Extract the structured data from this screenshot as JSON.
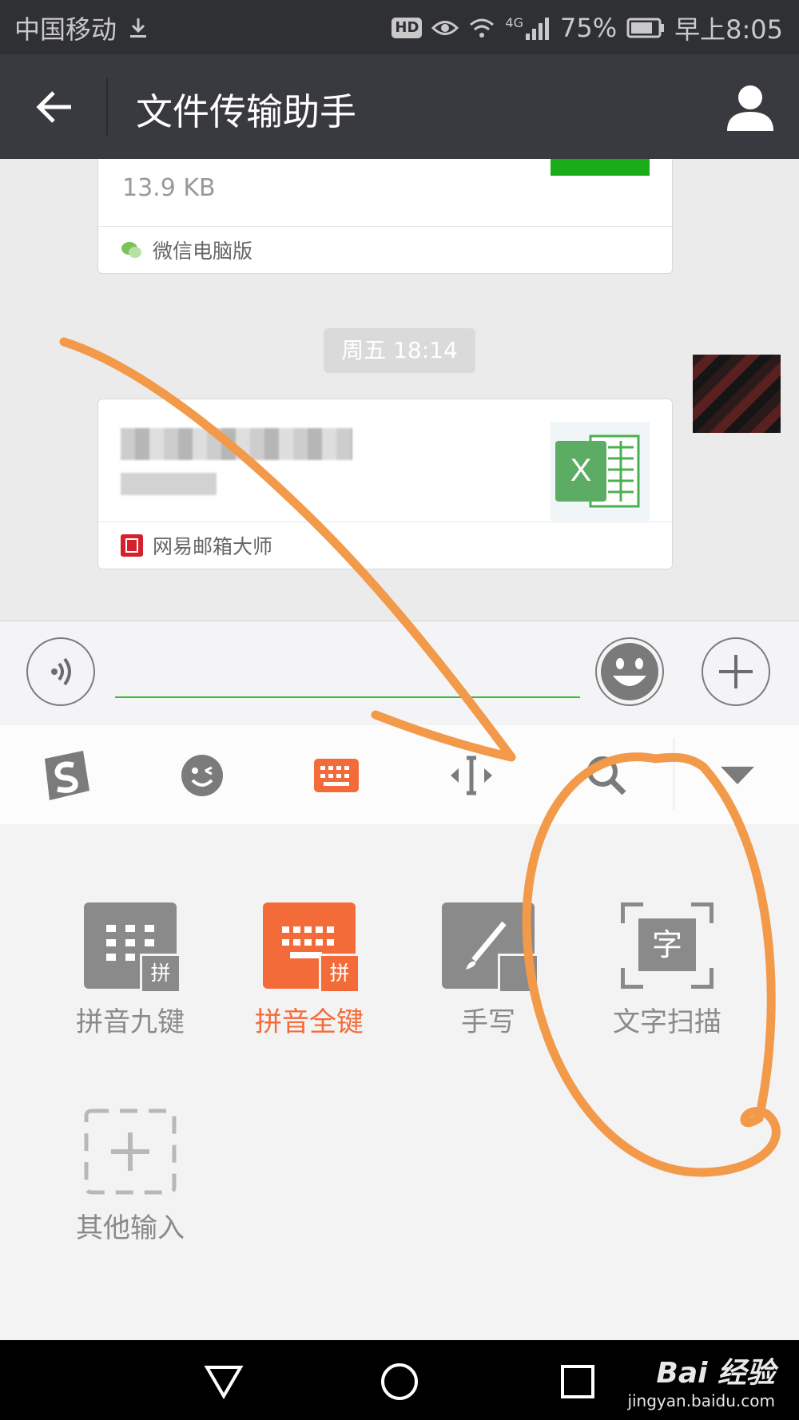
{
  "status_bar": {
    "carrier": "中国移动",
    "hd": "HD",
    "network": "4G",
    "battery": "75%",
    "time": "早上8:05"
  },
  "title_bar": {
    "title": "文件传输助手"
  },
  "messages": {
    "file1": {
      "size": "13.9 KB",
      "source": "微信电脑版"
    },
    "timestamp": "周五 18:14",
    "file2": {
      "icon_letter": "X",
      "source": "网易邮箱大师"
    }
  },
  "keyboard": {
    "modes": [
      {
        "label": "拼音九键",
        "badge": "拼",
        "active": false
      },
      {
        "label": "拼音全键",
        "badge": "拼",
        "active": true
      },
      {
        "label": "手写",
        "badge": "",
        "active": false
      },
      {
        "label": "文字扫描",
        "glyph": "字",
        "active": false
      },
      {
        "label": "其他输入",
        "active": false
      }
    ]
  },
  "watermark": {
    "brand": "Bai 经验",
    "url": "jingyan.baidu.com"
  },
  "colors": {
    "accent_orange": "#f46b3a",
    "wechat_green": "#1aad19",
    "annotation": "#f29a4a"
  }
}
